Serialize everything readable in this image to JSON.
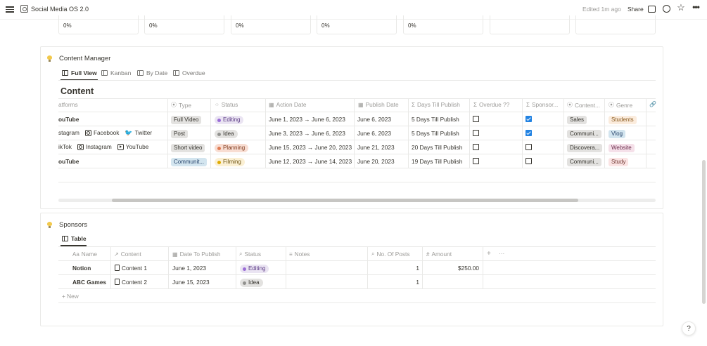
{
  "topbar": {
    "title": "Social Media OS 2.0",
    "edited": "Edited 1m ago",
    "share": "Share"
  },
  "progress_cards": [
    "0%",
    "0%",
    "0%",
    "0%",
    "0%",
    "",
    ""
  ],
  "content_manager": {
    "title": "Content Manager",
    "tabs": [
      "Full View",
      "Kanban",
      "By Date",
      "Overdue"
    ],
    "db_title": "Content",
    "columns": [
      "atforms",
      "Type",
      "Status",
      "Action Date",
      "Publish Date",
      "Days Till Publish",
      "Overdue ??",
      "Sponsor...",
      "Content...",
      "Genre"
    ],
    "rows": [
      {
        "platforms": [
          "ouTube"
        ],
        "type": "Full Video",
        "status": "Editing",
        "action_date": "June 1, 2023 → June 6, 2023",
        "publish_date": "June 6, 2023",
        "days": "5 Days Till Publish",
        "overdue": false,
        "sponsor": true,
        "content": "Sales",
        "genre": "Students"
      },
      {
        "platforms": [
          "stagram",
          "Facebook",
          "Twitter"
        ],
        "type": "Post",
        "status": "Idea",
        "action_date": "June 3, 2023 → June 6, 2023",
        "publish_date": "June 6, 2023",
        "days": "5 Days Till Publish",
        "overdue": false,
        "sponsor": true,
        "content": "Communi...",
        "genre": "Vlog"
      },
      {
        "platforms": [
          "ikTok",
          "Instagram",
          "YouTube"
        ],
        "type": "Short video",
        "status": "Planning",
        "action_date": "June 15, 2023 → June 20, 2023",
        "publish_date": "June 21, 2023",
        "days": "20 Days Till Publish",
        "overdue": false,
        "sponsor": false,
        "content": "Discovera...",
        "genre": "Website"
      },
      {
        "platforms": [
          "ouTube"
        ],
        "type": "Communit...",
        "status": "Filming",
        "action_date": "June 12, 2023 → June 14, 2023",
        "publish_date": "June 20, 2023",
        "days": "19 Days Till Publish",
        "overdue": false,
        "sponsor": false,
        "content": "Communi...",
        "genre": "Study"
      }
    ]
  },
  "sponsors": {
    "title": "Sponsors",
    "tab": "Table",
    "columns": [
      "Name",
      "Content",
      "Date To Publish",
      "Status",
      "Notes",
      "No. Of Posts",
      "Amount"
    ],
    "add_column": "+",
    "more_columns": "···",
    "rows": [
      {
        "name": "Notion",
        "content": "Content 1",
        "date": "June 1, 2023",
        "status": "Editing",
        "notes": "",
        "posts": "1",
        "amount": "$250.00"
      },
      {
        "name": "ABC Games",
        "content": "Content 2",
        "date": "June 15, 2023",
        "status": "Idea",
        "notes": "",
        "posts": "1",
        "amount": ""
      }
    ],
    "new_label": "+ New"
  },
  "help": "?",
  "colors": {
    "editing_bg": "#eae4f2",
    "editing_dot": "#9a6dd7",
    "idea_bg": "#e3e2e0",
    "idea_dot": "#91918e",
    "planning_bg": "#f8ddd2",
    "planning_dot": "#e07c53",
    "filming_bg": "#fbf0d4",
    "filming_dot": "#dfab01",
    "checkbox_checked": "#2383e2"
  }
}
